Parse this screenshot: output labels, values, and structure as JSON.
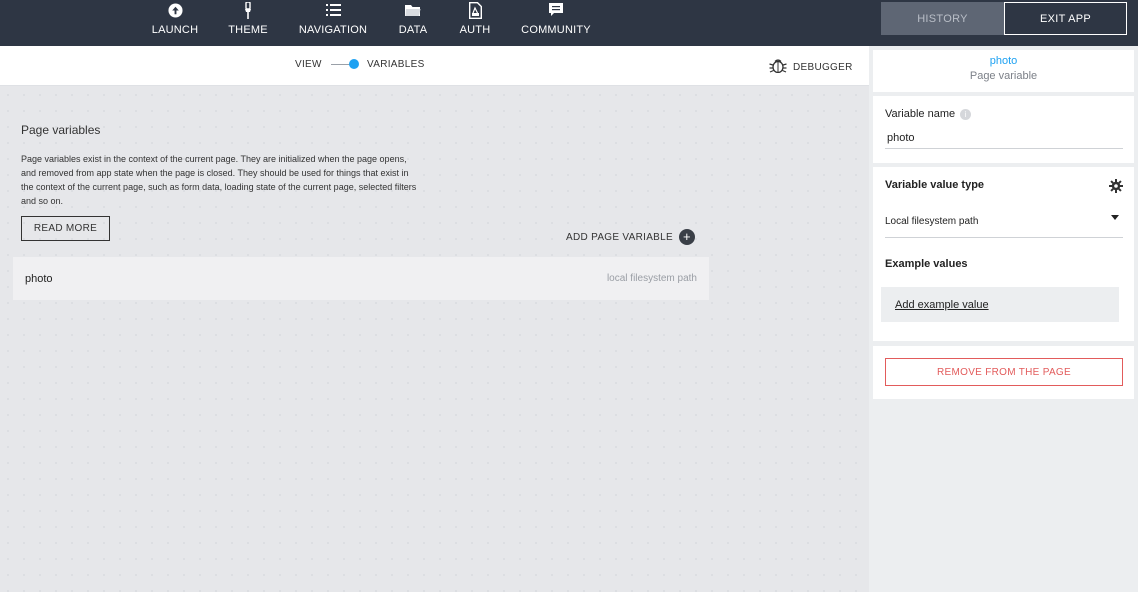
{
  "nav": {
    "items": [
      {
        "id": "launch",
        "label": "LAUNCH",
        "icon": "arrow-up-circle-icon"
      },
      {
        "id": "theme",
        "label": "THEME",
        "icon": "paintbrush-icon"
      },
      {
        "id": "navigation",
        "label": "NAVIGATION",
        "icon": "list-icon"
      },
      {
        "id": "data",
        "label": "DATA",
        "icon": "folder-icon"
      },
      {
        "id": "auth",
        "label": "AUTH",
        "icon": "file-lock-icon"
      },
      {
        "id": "community",
        "label": "COMMUNITY",
        "icon": "chat-bubble-icon"
      }
    ],
    "history_label": "HISTORY",
    "exit_label": "EXIT APP"
  },
  "subbar": {
    "view_label": "VIEW",
    "variables_label": "VARIABLES",
    "debugger_label": "DEBUGGER"
  },
  "main": {
    "title": "Page variables",
    "description": "Page variables exist in the context of the current page. They are initialized when the page opens, and removed from app state when the page is closed. They should be used for things that exist in the context of the current page, such as form data, loading state of the current page, selected filters and so on.",
    "read_more_label": "READ MORE",
    "add_variable_label": "ADD PAGE VARIABLE",
    "variables": [
      {
        "name": "photo",
        "type": "local filesystem path"
      }
    ]
  },
  "panel": {
    "variable_name": "photo",
    "variable_subtitle": "Page variable",
    "name_label": "Variable name",
    "name_value": "photo",
    "type_label": "Variable value type",
    "type_value": "Local filesystem path",
    "examples_label": "Example values",
    "add_example_label": "Add example value",
    "remove_label": "REMOVE FROM THE PAGE"
  },
  "colors": {
    "topbar": "#2e3644",
    "accent": "#1da1f2",
    "danger": "#e25b5b"
  }
}
